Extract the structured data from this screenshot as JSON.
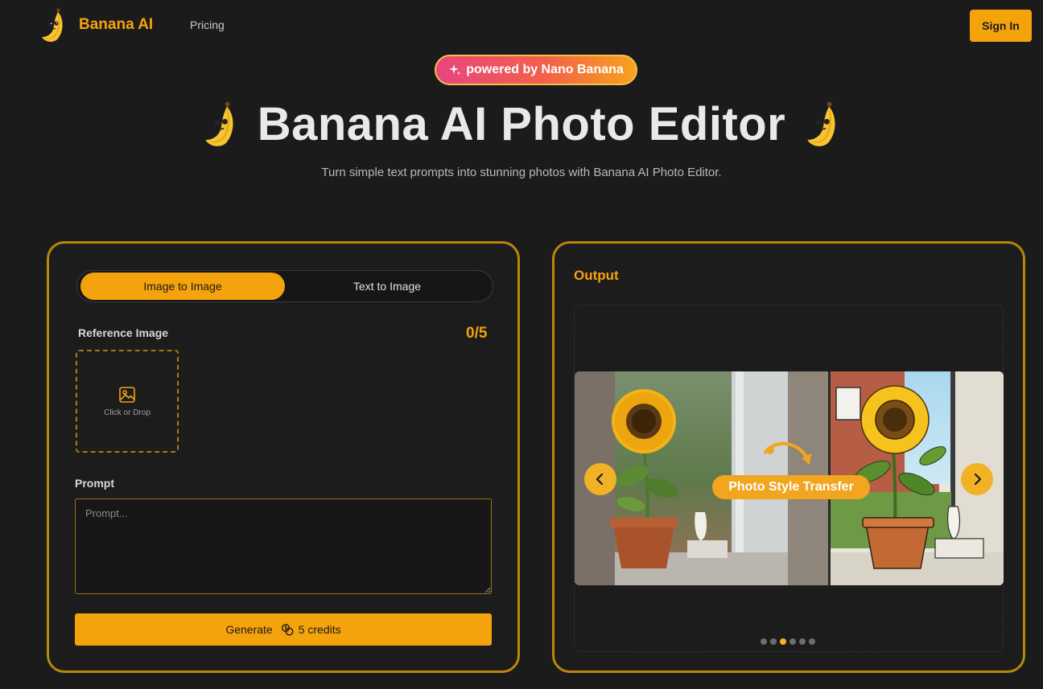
{
  "header": {
    "brand": "Banana AI",
    "nav": {
      "pricing": "Pricing"
    },
    "sign_in": "Sign In"
  },
  "hero": {
    "badge": "powered by Nano Banana",
    "title": "Banana AI Photo Editor",
    "subtitle": "Turn simple text prompts into stunning photos with Banana AI Photo Editor."
  },
  "editor": {
    "tabs": [
      "Image to Image",
      "Text to Image"
    ],
    "active_tab": "Image to Image",
    "reference_label": "Reference Image",
    "reference_count": "0/5",
    "dropzone_text": "Click or Drop",
    "prompt_label": "Prompt",
    "prompt_placeholder": "Prompt...",
    "prompt_value": "",
    "generate_label": "Generate",
    "credits": "5 credits"
  },
  "output": {
    "label": "Output",
    "slide_caption": "Photo Style Transfer",
    "slide_count": 6,
    "active_slide": 2
  },
  "colors": {
    "accent": "#f5a30d",
    "background": "#1b1b1b",
    "panel_border": "#b8860b"
  },
  "icons": {
    "logo": "banana-mascot-icon",
    "badge": "sparkle-icon",
    "dropzone": "image-icon",
    "credits": "coins-icon",
    "prev": "chevron-left-icon",
    "next": "chevron-right-icon"
  }
}
